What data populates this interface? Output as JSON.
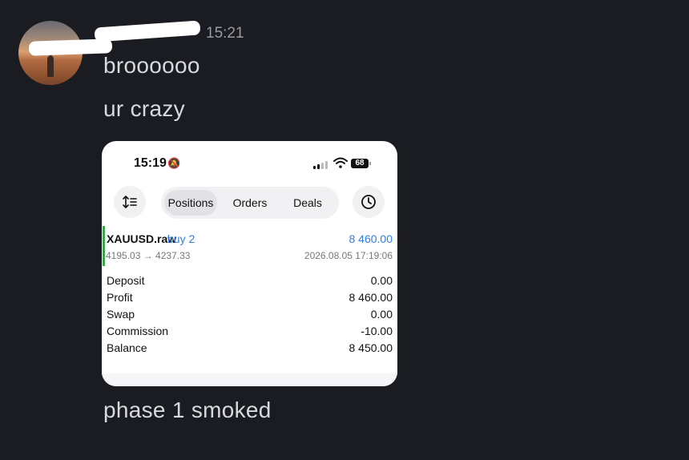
{
  "message": {
    "timestamp": "15:21",
    "lines": [
      "broooooo",
      "ur crazy",
      "phase 1 smoked"
    ]
  },
  "screenshot": {
    "status": {
      "time": "15:19",
      "battery": "68"
    },
    "tabs": [
      "Positions",
      "Orders",
      "Deals"
    ],
    "active_tab": "Positions",
    "position": {
      "symbol": "XAUUSD.raw",
      "side": "buy 2",
      "profit": "8 460.00",
      "prices": "4195.03 → 4237.33",
      "open_time": "2026.08.05 17:19:06"
    },
    "details": [
      {
        "label": "Deposit",
        "value": "0.00"
      },
      {
        "label": "Profit",
        "value": "8 460.00"
      },
      {
        "label": "Swap",
        "value": "0.00"
      },
      {
        "label": "Commission",
        "value": "-10.00"
      },
      {
        "label": "Balance",
        "value": "8 450.00"
      }
    ]
  }
}
